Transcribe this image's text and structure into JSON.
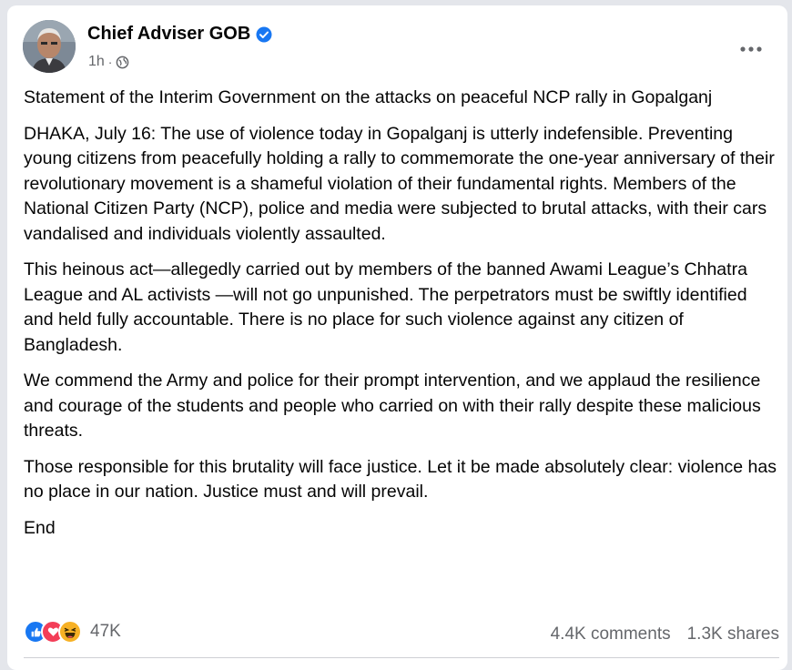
{
  "post": {
    "author": "Chief Adviser GOB",
    "time": "1h",
    "privacy_icon": "globe-icon",
    "verified_icon": "verified-badge-icon",
    "more_icon": "more-options-icon",
    "paragraphs": [
      "Statement of the Interim Government on the attacks on peaceful NCP rally in Gopalganj",
      "DHAKA, July 16: The use of violence today in Gopalganj is utterly indefensible. Preventing young citizens from peacefully holding a rally to commemorate the one-year anniversary of their revolutionary movement is a shameful violation of their fundamental rights. Members of the National Citizen Party (NCP), police and media were subjected to brutal attacks, with their cars vandalised and individuals violently assaulted.",
      "This heinous act—allegedly carried out by members of the banned Awami League’s Chhatra League and AL activists —will not go unpunished. The perpetrators must be swiftly identified and held fully accountable. There is no place for such violence against any citizen of Bangladesh.",
      "We commend the Army and police for their prompt intervention, and we applaud the resilience and courage of the students and people who carried on with their rally despite these malicious threats.",
      "Those responsible for this brutality will face justice. Let it be made absolutely clear: violence has no place in our nation. Justice must and will prevail.",
      "End"
    ]
  },
  "engagement": {
    "reactions": [
      "like-icon",
      "love-icon",
      "haha-icon"
    ],
    "reaction_count": "47K",
    "comments": "4.4K comments",
    "shares": "1.3K shares"
  },
  "colors": {
    "like": "#1877f2",
    "love": "#f33e58",
    "haha": "#f7b125",
    "verified": "#1877f2",
    "secondary_text": "#65676b"
  }
}
